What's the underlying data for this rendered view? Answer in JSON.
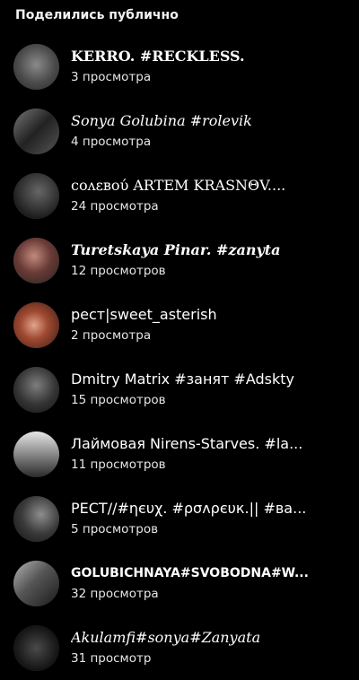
{
  "header": {
    "title": "Поделились публично"
  },
  "rows": [
    {
      "name": "KERRO. #RECKLESS.",
      "views": "3 просмотра"
    },
    {
      "name": "Sonya Golubina #rolevik",
      "views": "4 просмотра"
    },
    {
      "name": "соʌεвоύ ARTEM KRASNΘV....",
      "views": "24 просмотра"
    },
    {
      "name": "Turetskaya Pinar. #zanyta",
      "views": "12 просмотров"
    },
    {
      "name": "рест|sweet_asterish",
      "views": "2 просмотра"
    },
    {
      "name": "Dmitry Matrix #занят #Adskty",
      "views": "15 просмотров"
    },
    {
      "name": "Лаймовая Nirens-Starves. #la...",
      "views": "11 просмотров"
    },
    {
      "name": "РЕСТ//#ηєυχ. #ρσʌρєυк.|| #ва...",
      "views": "5 просмотров"
    },
    {
      "name": "GOLUBICHNAYA#SVOBODNA#W...",
      "views": "32 просмотра"
    },
    {
      "name": "Akulamfi#sonya#Zanyata",
      "views": "31 просмотр"
    }
  ],
  "avatars": [
    {
      "icon": "avatar-photo-1",
      "color": "#5a5a5a"
    },
    {
      "icon": "avatar-photo-2",
      "color": "#3c3c3c"
    },
    {
      "icon": "avatar-photo-3",
      "color": "#2a2a2a"
    },
    {
      "icon": "avatar-photo-4",
      "color": "#6b3b36"
    },
    {
      "icon": "avatar-photo-5",
      "color": "#7a3a2e"
    },
    {
      "icon": "avatar-photo-6",
      "color": "#3a3a3a"
    },
    {
      "icon": "avatar-photo-7",
      "color": "#9a9a9a"
    },
    {
      "icon": "avatar-photo-8",
      "color": "#2d2d2d"
    },
    {
      "icon": "avatar-photo-9",
      "color": "#4a4a4a"
    },
    {
      "icon": "avatar-photo-10",
      "color": "#1a1a1a"
    }
  ]
}
